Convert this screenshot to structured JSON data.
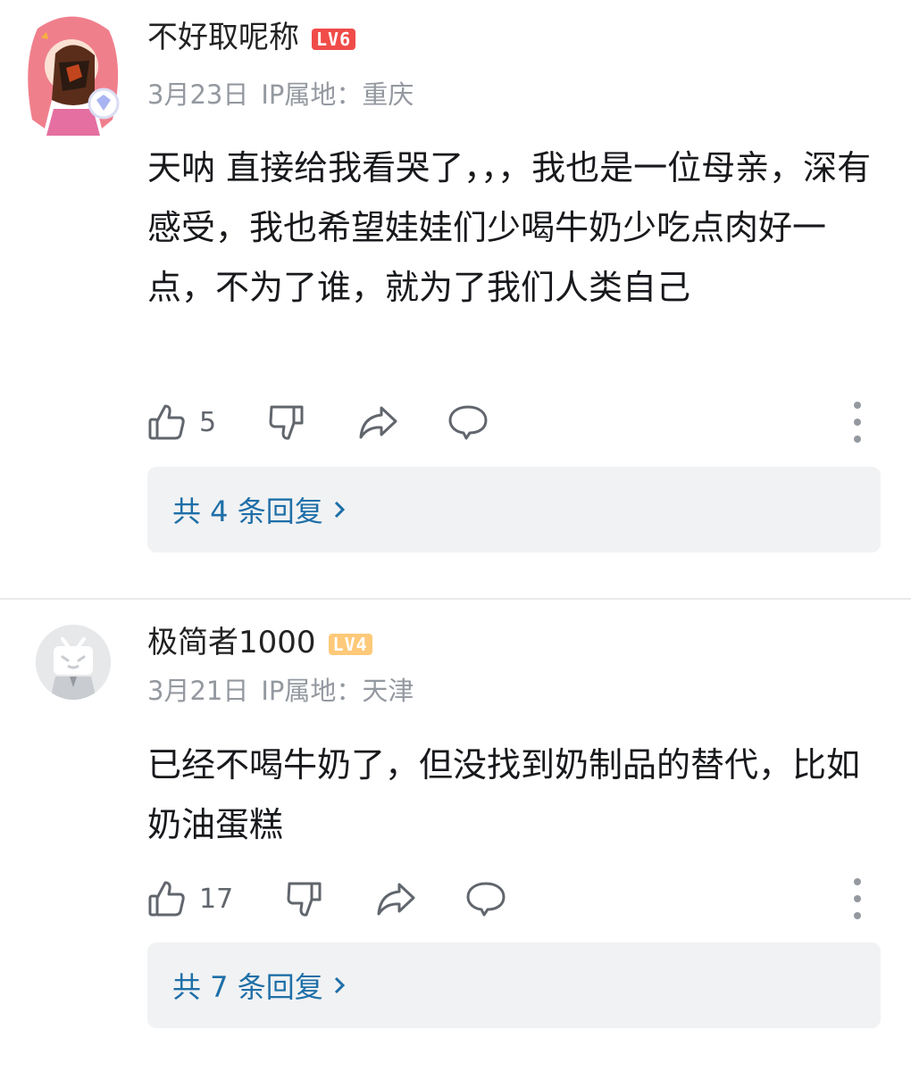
{
  "comments": [
    {
      "username": "不好取呢称",
      "level": "LV6",
      "date": "3月23日",
      "location": "IP属地：重庆",
      "text": "天呐 直接给我看哭了，，，我也是一位母亲，深有感受，我也希望娃娃们少喝牛奶少吃点肉好一点，不为了谁，就为了我们人类自己",
      "like_count": "5",
      "replies_label": "共 4 条回复"
    },
    {
      "username": "极简者1000",
      "level": "LV4",
      "date": "3月21日",
      "location": "IP属地：天津",
      "text": "已经不喝牛奶了，但没找到奶制品的替代，比如奶油蛋糕",
      "like_count": "17",
      "replies_label": "共 7 条回复"
    }
  ],
  "colors": {
    "level6": "#f04c49",
    "level4": "#fec979",
    "link": "#1e6fa8",
    "secondary": "#9499a0"
  },
  "icons": [
    "like-icon",
    "dislike-icon",
    "share-icon",
    "reply-icon",
    "more-icon",
    "chevron-right-icon"
  ]
}
